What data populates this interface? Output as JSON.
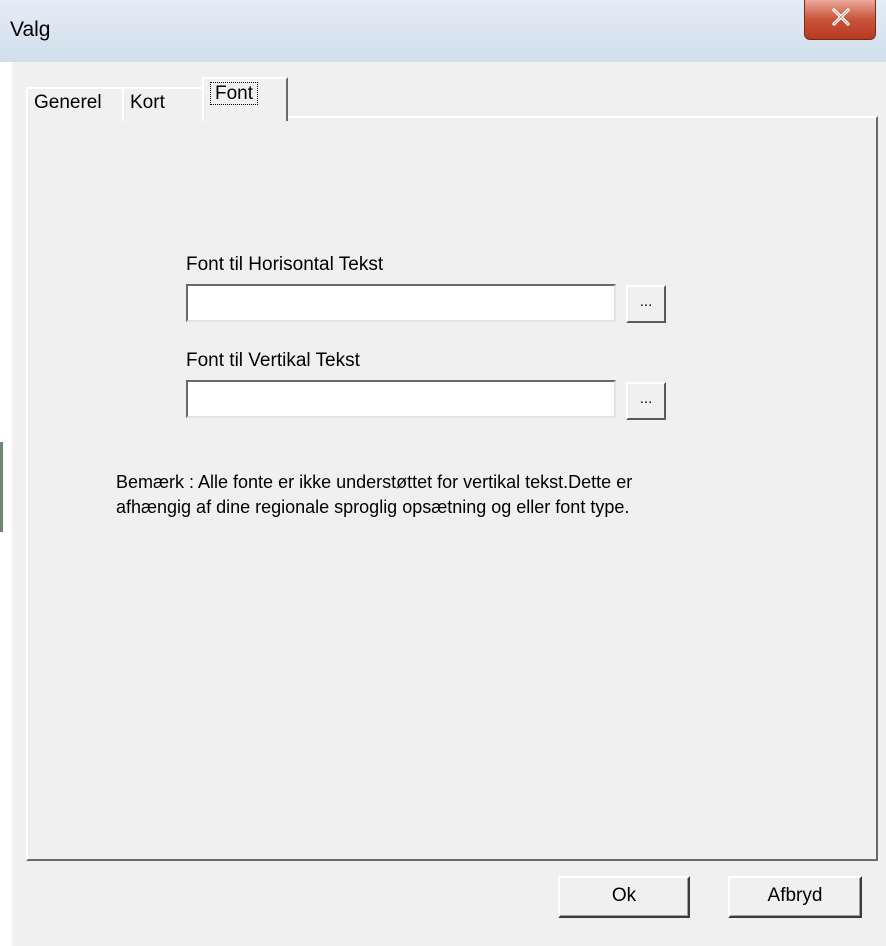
{
  "window": {
    "title": "Valg",
    "close_glyph": "X"
  },
  "tabs": [
    {
      "label": "Generel"
    },
    {
      "label": "Kort"
    },
    {
      "label": "Font"
    }
  ],
  "active_tab": "Font",
  "fields": {
    "horizontal_label": "Font til Horisontal Tekst",
    "horizontal_value": "",
    "horizontal_browse": "...",
    "vertical_label": "Font til Vertikal Tekst",
    "vertical_value": "",
    "vertical_browse": "..."
  },
  "note": {
    "line1": "Bemærk : Alle fonte er ikke understøttet for vertikal tekst.Dette er",
    "line2": "afhængig af dine regionale sproglig opsætning og eller font type."
  },
  "buttons": {
    "ok": "Ok",
    "cancel": "Afbryd"
  },
  "icons": {
    "close": "close-icon"
  },
  "colors": {
    "dialog_bg": "#f0f0f0",
    "close_button": "#c8543a"
  }
}
